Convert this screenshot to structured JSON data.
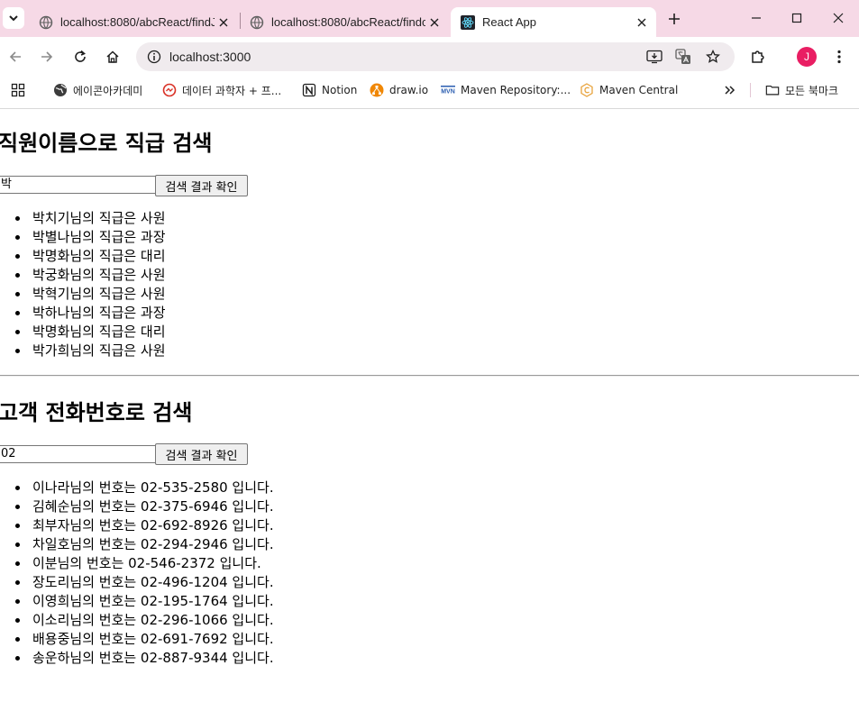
{
  "browser": {
    "tabs": [
      {
        "title": "localhost:8080/abcReact/findJ",
        "active": false
      },
      {
        "title": "localhost:8080/abcReact/findc",
        "active": false
      },
      {
        "title": "React App",
        "active": true
      }
    ],
    "address": "localhost:3000",
    "profile_initial": "J",
    "bookmarks": [
      {
        "label": "에이콘아카데미",
        "icon": "globe-icon"
      },
      {
        "label": "데이터 과학자 + 프...",
        "icon": "red-circle-icon"
      },
      {
        "label": "Notion",
        "icon": "notion-icon"
      },
      {
        "label": "draw.io",
        "icon": "drawio-icon"
      },
      {
        "label": "Maven Repository:...",
        "icon": "mvn-icon"
      },
      {
        "label": "Maven Central",
        "icon": "maven-central-icon"
      }
    ],
    "all_bookmarks_label": "모든 북마크",
    "colors": {
      "tabstrip": "#f6d9e6",
      "omnibox": "#f0ebee",
      "avatar": "#e91e63"
    }
  },
  "employee_search": {
    "title": "직원이름으로 직급 검색",
    "input_value": "박",
    "button_label": "검색 결과 확인",
    "results": [
      "박치기님의 직급은 사원",
      "박별나님의 직급은 과장",
      "박명화님의 직급은 대리",
      "박궁화님의 직급은 사원",
      "박혁기님의 직급은 사원",
      "박하나님의 직급은 과장",
      "박명화님의 직급은 대리",
      "박가희님의 직급은 사원"
    ]
  },
  "customer_search": {
    "title": "고객 전화번호로 검색",
    "input_value": "02",
    "button_label": "검색 결과 확인",
    "results": [
      "이나라님의 번호는 02-535-2580 입니다.",
      "김혜순님의 번호는 02-375-6946 입니다.",
      "최부자님의 번호는 02-692-8926 입니다.",
      "차일호님의 번호는 02-294-2946 입니다.",
      "이분님의 번호는 02-546-2372 입니다.",
      "장도리님의 번호는 02-496-1204 입니다.",
      "이영희님의 번호는 02-195-1764 입니다.",
      "이소리님의 번호는 02-296-1066 입니다.",
      "배용중님의 번호는 02-691-7692 입니다.",
      "송운하님의 번호는 02-887-9344 입니다."
    ]
  }
}
